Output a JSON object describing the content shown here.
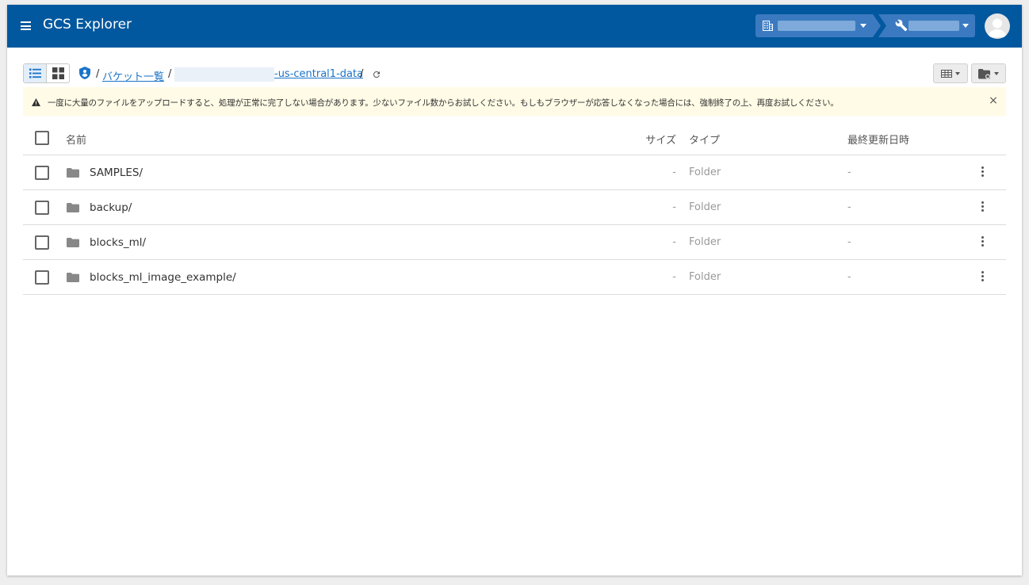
{
  "header": {
    "title": "GCS Explorer",
    "org_icon": "building-icon",
    "project_icon": "wrench-icon"
  },
  "toolbar": {
    "breadcrumb": {
      "sep": "/",
      "root_label": "バケット一覧",
      "bucket_suffix": "-us-central1-data",
      "trailing_sep": "/"
    }
  },
  "warning": {
    "text": "一度に大量のファイルをアップロードすると、処理が正常に完了しない場合があります。少ないファイル数からお試しください。もしもブラウザーが応答しなくなった場合には、強制終了の上、再度お試しください。",
    "close": "×"
  },
  "table": {
    "headers": {
      "name": "名前",
      "size": "サイズ",
      "type": "タイプ",
      "modified": "最終更新日時"
    },
    "rows": [
      {
        "name": "SAMPLES/",
        "size": "-",
        "type": "Folder",
        "modified": "-"
      },
      {
        "name": "backup/",
        "size": "-",
        "type": "Folder",
        "modified": "-"
      },
      {
        "name": "blocks_ml/",
        "size": "-",
        "type": "Folder",
        "modified": "-"
      },
      {
        "name": "blocks_ml_image_example/",
        "size": "-",
        "type": "Folder",
        "modified": "-"
      }
    ]
  },
  "colors": {
    "appbar": "#02589f",
    "link": "#1a73c8",
    "warning_bg": "#fffbe6"
  }
}
